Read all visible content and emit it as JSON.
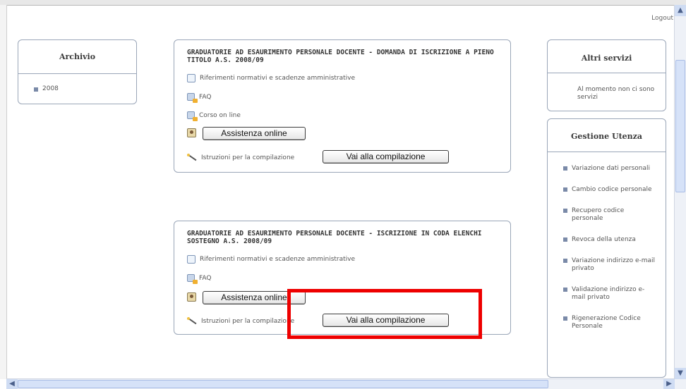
{
  "header": {
    "logout": "Logout"
  },
  "archivio": {
    "title": "Archivio",
    "items": [
      "2008"
    ]
  },
  "cards": [
    {
      "title": "GRADUATORIE AD ESAURIMENTO PERSONALE DOCENTE - DOMANDA DI ISCRIZIONE A PIENO TITOLO A.S. 2008/09",
      "riferimenti": "Riferimenti normativi e scadenze amministrative",
      "faq": "FAQ",
      "corso": "Corso on line",
      "assistenza": "Assistenza online",
      "istruzioni": "Istruzioni per la compilazione",
      "vai": "Vai alla compilazione"
    },
    {
      "title": "GRADUATORIE AD ESAURIMENTO PERSONALE DOCENTE - ISCRIZIONE IN CODA ELENCHI SOSTEGNO A.S. 2008/09",
      "riferimenti": "Riferimenti normativi e scadenze amministrative",
      "faq": "FAQ",
      "assistenza": "Assistenza online",
      "istruzioni": "Istruzioni per la compilazione",
      "vai": "Vai alla compilazione"
    }
  ],
  "altri_servizi": {
    "title": "Altri servizi",
    "text": "Al momento non ci sono servizi"
  },
  "gestione_utenza": {
    "title": "Gestione Utenza",
    "items": [
      "Variazione dati personali",
      "Cambio codice personale",
      "Recupero codice personale",
      "Revoca della utenza",
      "Variazione indirizzo e-mail privato",
      "Validazione indirizzo e-mail privato",
      "Rigenerazione Codice Personale"
    ]
  },
  "colors": {
    "highlight": "#ee0000",
    "box_border": "#9aa6b8"
  }
}
